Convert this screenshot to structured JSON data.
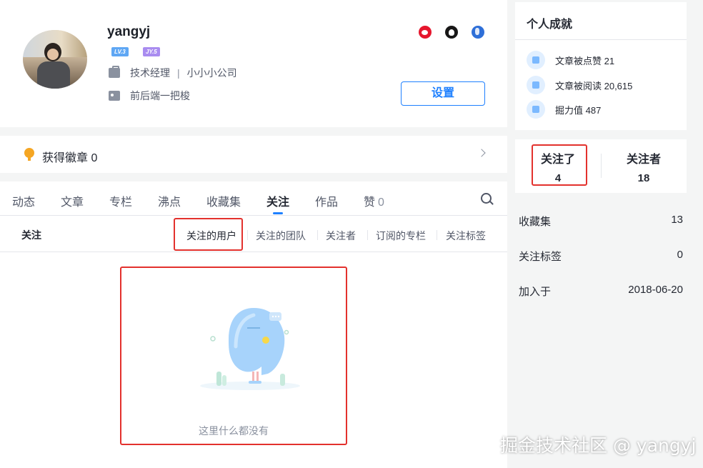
{
  "profile": {
    "username": "yangyj",
    "level_badge": "LV.3",
    "jy_badge": "JY.5",
    "job_title": "技术经理",
    "company": "小小小公司",
    "separator": "|",
    "bio": "前后端一把梭",
    "settings_label": "设置"
  },
  "badges": {
    "label": "获得徽章 0"
  },
  "tabs": [
    {
      "label": "动态"
    },
    {
      "label": "文章"
    },
    {
      "label": "专栏"
    },
    {
      "label": "沸点"
    },
    {
      "label": "收藏集"
    },
    {
      "label": "关注"
    },
    {
      "label": "作品"
    },
    {
      "label": "赞",
      "count": "0"
    }
  ],
  "active_tab": "关注",
  "follow_section": {
    "title": "关注",
    "subtabs": [
      {
        "label": "关注的用户"
      },
      {
        "label": "关注的团队"
      },
      {
        "label": "关注者"
      },
      {
        "label": "订阅的专栏"
      },
      {
        "label": "关注标签"
      }
    ],
    "active_subtab": "关注的用户",
    "empty_text": "这里什么都没有"
  },
  "achievements": {
    "title": "个人成就",
    "items": [
      {
        "icon": "thumbs-up-icon",
        "label": "文章被点赞 21"
      },
      {
        "icon": "eye-icon",
        "label": "文章被阅读 20,615"
      },
      {
        "icon": "trend-icon",
        "label": "掘力值 487"
      }
    ]
  },
  "follow_stats": {
    "following_label": "关注了",
    "following_count": "4",
    "followers_label": "关注者",
    "followers_count": "18"
  },
  "stats": [
    {
      "label": "收藏集",
      "value": "13"
    },
    {
      "label": "关注标签",
      "value": "0"
    },
    {
      "label": "加入于",
      "value": "2018-06-20"
    }
  ],
  "watermark": "掘金技术社区 @ yangyj",
  "colors": {
    "accent": "#1e80ff",
    "highlight_box": "#e3312d",
    "background": "#f4f5f5"
  }
}
